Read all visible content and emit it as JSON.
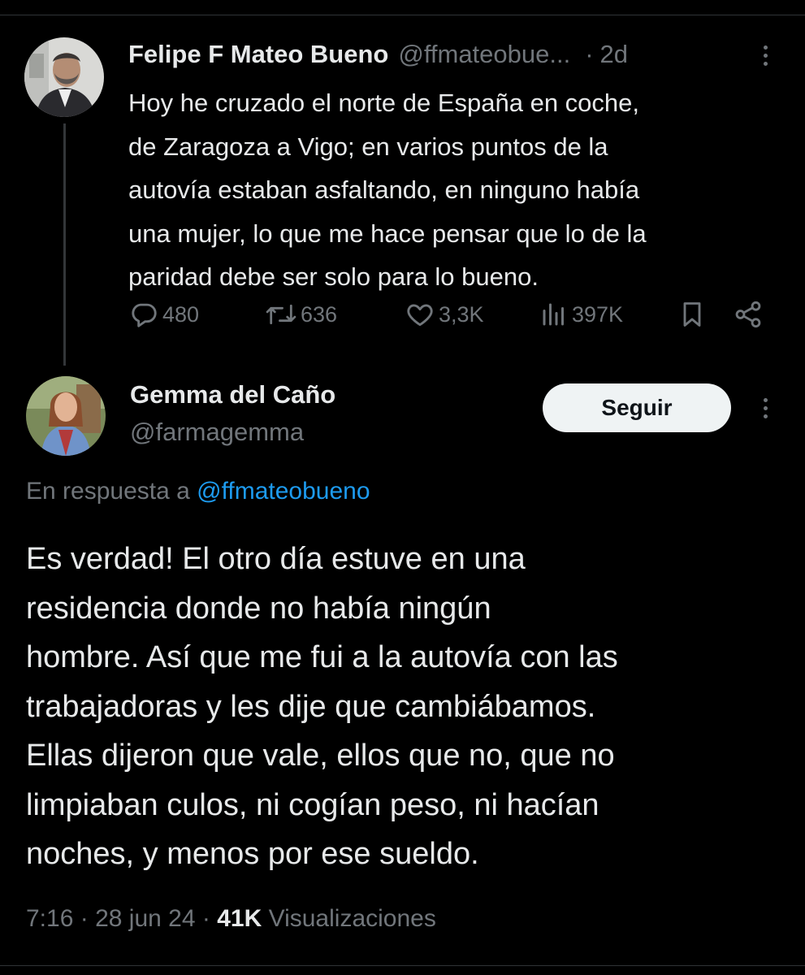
{
  "tweet1": {
    "author_name": "Felipe F Mateo Bueno",
    "handle": "@ffmateobue...",
    "separator": "·",
    "time": "2d",
    "lines": [
      "Hoy he cruzado el norte de España en coche,",
      "de Zaragoza a Vigo; en varios puntos de la",
      "autovía estaban asfaltando, en ninguno había",
      "una mujer, lo que me hace pensar que lo de la",
      "paridad debe ser solo para lo bueno."
    ],
    "actions": {
      "replies": "480",
      "reposts": "636",
      "likes": "3,3K",
      "views": "397K"
    }
  },
  "tweet2": {
    "author_name": "Gemma del Caño",
    "handle": "@farmagemma",
    "follow_label": "Seguir",
    "reply_prefix": "En respuesta a ",
    "reply_handle": "@ffmateobueno",
    "lines": [
      "Es verdad! El otro día estuve en una",
      "residencia donde no había ningún",
      "hombre. Así que me fui a la autovía con las",
      "trabajadoras y les dije que cambiábamos.",
      "Ellas dijeron que vale, ellos que no, que no",
      "limpiaban culos, ni cogían peso, ni hacían",
      "noches, y menos por ese sueldo."
    ],
    "time": "7:16",
    "sep1": "·",
    "date": "28 jun 24",
    "sep2": "·",
    "views_count": "41K",
    "views_label": "Visualizaciones"
  },
  "icons": {
    "reply": "reply-icon",
    "repost": "repost-icon",
    "like": "like-icon",
    "views": "views-icon",
    "bookmark": "bookmark-icon",
    "share": "share-icon",
    "more": "more-icon"
  },
  "colors": {
    "background": "#000000",
    "text": "#e7e9ea",
    "muted": "#71767b",
    "link": "#1d9bf0",
    "button_bg": "#eff3f4",
    "button_text": "#0f1419"
  }
}
